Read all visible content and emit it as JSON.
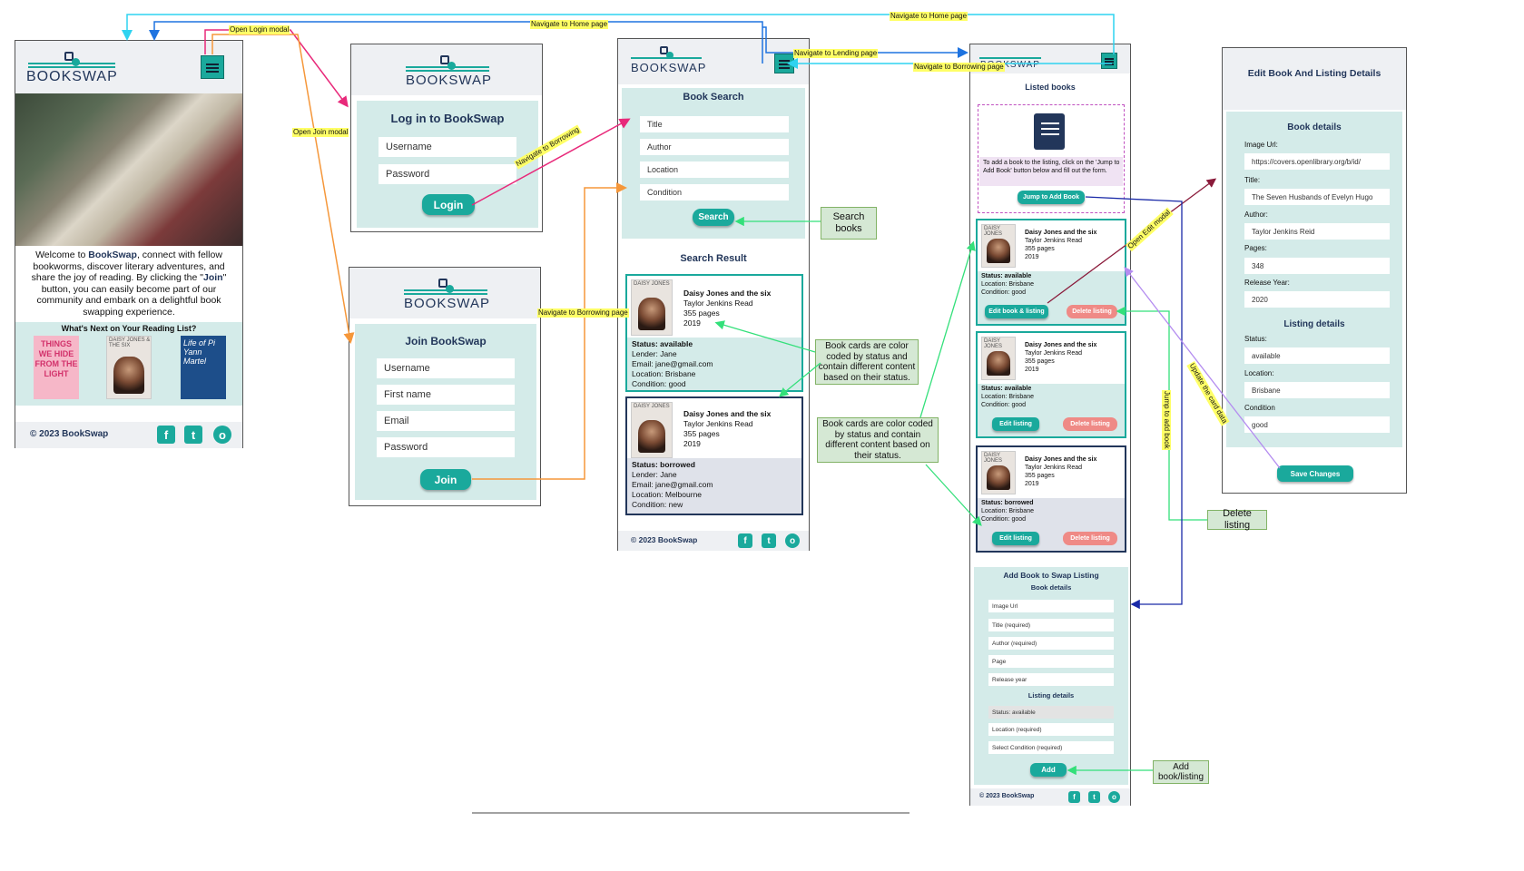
{
  "common": {
    "brand": "BOOKSWAP",
    "username": "Username",
    "password": "Password",
    "copyright": "© 2023 BookSwap",
    "social": {
      "fb": "f",
      "tw": "t",
      "ig": "o"
    }
  },
  "home": {
    "welcome_pre": "Welcome to ",
    "welcome_brand": "BookSwap",
    "welcome_mid": ", connect with fellow bookworms, discover literary adventures, and share the joy of reading. By clicking the \"",
    "welcome_join": "Join",
    "welcome_post": "\" button, you can easily become part of our community and embark on a delightful book swapping experience.",
    "next_heading": "What's Next on Your Reading List?",
    "covers": [
      {
        "text": "THINGS WE HIDE FROM THE LIGHT"
      },
      {
        "text": "DAISY JONES & THE SIX"
      },
      {
        "text": "Life of Pi  Yann Martel"
      }
    ]
  },
  "login": {
    "title": "Log in to BookSwap",
    "button": "Login"
  },
  "join": {
    "title": "Join BookSwap",
    "first_name": "First name",
    "email": "Email",
    "button": "Join"
  },
  "search": {
    "title": "Book Search",
    "fields": [
      "Title",
      "Author",
      "Location",
      "Condition"
    ],
    "button": "Search",
    "results_title": "Search Result",
    "cards": [
      {
        "book": "Daisy Jones and the six",
        "author": "Taylor Jenkins Read",
        "pages": "355 pages",
        "year": "2019",
        "status": "Status: available",
        "lender": "Lender: Jane",
        "email": "Email: jane@gmail.com",
        "location": "Location: Brisbane",
        "condition": "Condition: good"
      },
      {
        "book": "Daisy Jones and the six",
        "author": "Taylor Jenkins Read",
        "pages": "355 pages",
        "year": "2019",
        "status": "Status: borrowed",
        "lender": "Lender: Jane",
        "email": "Email: jane@gmail.com",
        "location": "Location: Melbourne",
        "condition": "Condition: new"
      }
    ]
  },
  "lending": {
    "title": "Listed books",
    "info": "To add a book to the listing, click on the 'Jump to Add Book' button below and fill out the form.",
    "jump_button": "Jump to Add Book",
    "cards": [
      {
        "book": "Daisy Jones and the six",
        "author": "Taylor Jenkins Read",
        "pages": "355 pages",
        "year": "2019",
        "status": "Status: available",
        "location": "Location: Brisbane",
        "condition": "Condition: good",
        "edit": "Edit book & listing",
        "delete": "Delete listing"
      },
      {
        "book": "Daisy Jones and the six",
        "author": "Taylor Jenkins Read",
        "pages": "355 pages",
        "year": "2019",
        "status": "Status: available",
        "location": "Location: Brisbane",
        "condition": "Condition: good",
        "edit": "Edit listing",
        "delete": "Delete listing"
      },
      {
        "book": "Daisy Jones and the six",
        "author": "Taylor Jenkins Read",
        "pages": "355 pages",
        "year": "2019",
        "status": "Status: borrowed",
        "location": "Location: Brisbane",
        "condition": "Condition: good",
        "edit": "Edit listing",
        "delete": "Delete listing"
      }
    ],
    "add_title": "Add Book to Swap Listing",
    "book_details": "Book details",
    "add_fields": [
      "Image Url",
      "Title (required)",
      "Author (required)",
      "Page",
      "Release year"
    ],
    "listing_details": "Listing details",
    "listing_fields": [
      "Status: available",
      "Location (required)",
      "Select Condition (required)"
    ],
    "add_button": "Add"
  },
  "edit": {
    "title": "Edit Book And Listing Details",
    "book_details": "Book details",
    "fields": [
      {
        "label": "Image Url:",
        "value": "https://covers.openlibrary.org/b/id/"
      },
      {
        "label": "Title:",
        "value": "The Seven Husbands of Evelyn Hugo"
      },
      {
        "label": "Author:",
        "value": "Taylor Jenkins Reid"
      },
      {
        "label": "Pages:",
        "value": "348"
      },
      {
        "label": "Release Year:",
        "value": "2020"
      }
    ],
    "listing_details": "Listing details",
    "listing_fields": [
      {
        "label": "Status:",
        "value": "available"
      },
      {
        "label": "Location:",
        "value": "Brisbane"
      },
      {
        "label": "Condition",
        "value": "good"
      }
    ],
    "button": "Save Changes"
  },
  "notes": {
    "search_books": "Search books",
    "color_coded_1": "Book cards are color coded by status and contain different content based on their status.",
    "color_coded_2": "Book cards are color coded by status and contain different content based on their status.",
    "delete_listing": "Delete listing",
    "add_book": "Add book/listing"
  },
  "arrow_labels": {
    "open_login": "Open Login modal",
    "open_join": "Open Join modal",
    "nav_home_1": "Navigate to Home page",
    "nav_home_2": "Navigate to Home page",
    "nav_lending": "Navigate to Lending page",
    "nav_borrowing_1": "Navigate to Borrowing page",
    "nav_borrowing_2": "Navigate to Borrowing",
    "nav_borrowing_3": "Navigate to Borrowing page",
    "open_edit": "Open Edit modal",
    "jump_add": "Jump to add book",
    "update_card": "Update the card data"
  },
  "colors": {
    "teal": "#1aa99c",
    "panel": "#d4ebe9",
    "navy": "#22365a",
    "red": "#ef8a86"
  }
}
